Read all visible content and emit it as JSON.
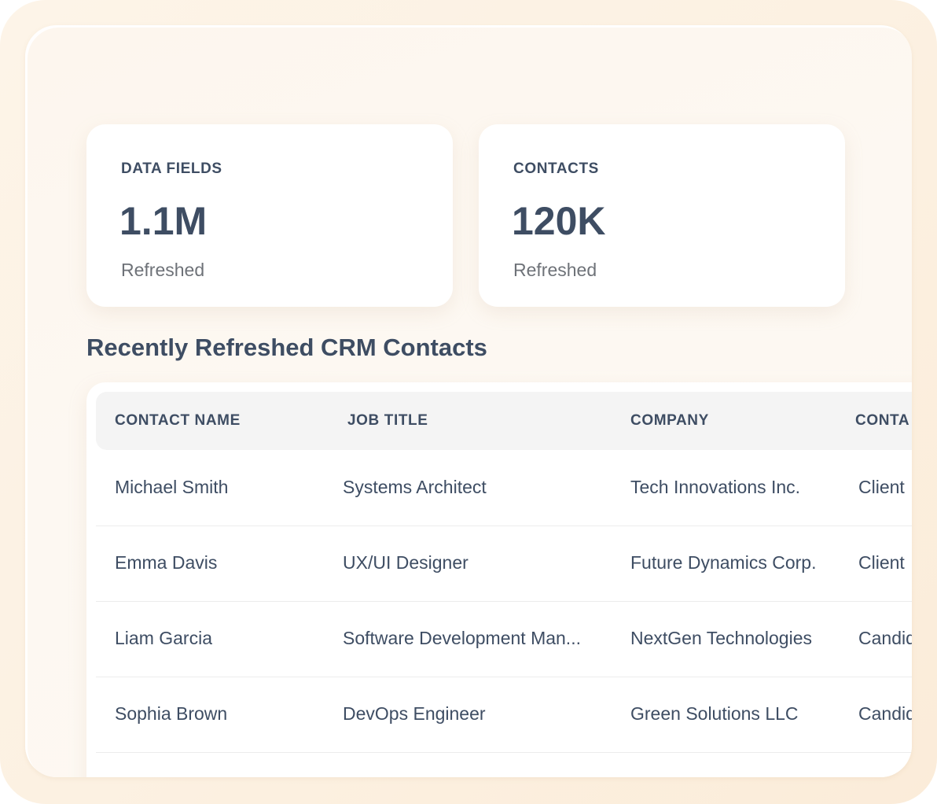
{
  "stats": [
    {
      "label": "DATA FIELDS",
      "value": "1.1M",
      "sub": "Refreshed"
    },
    {
      "label": "CONTACTS",
      "value": "120K",
      "sub": "Refreshed"
    }
  ],
  "section_title": "Recently Refreshed CRM Contacts",
  "table": {
    "columns": [
      "CONTACT NAME",
      "JOB TITLE",
      "COMPANY",
      "CONTA"
    ],
    "rows": [
      {
        "name": "Michael Smith",
        "title": "Systems Architect",
        "company": "Tech Innovations Inc.",
        "type": "Client"
      },
      {
        "name": "Emma Davis",
        "title": "UX/UI Designer",
        "company": "Future Dynamics Corp.",
        "type": "Client"
      },
      {
        "name": "Liam Garcia",
        "title": "Software Development Man...",
        "company": "NextGen Technologies",
        "type": "Candid"
      },
      {
        "name": "Sophia Brown",
        "title": "DevOps Engineer",
        "company": "Green Solutions LLC",
        "type": "Candid"
      }
    ]
  }
}
